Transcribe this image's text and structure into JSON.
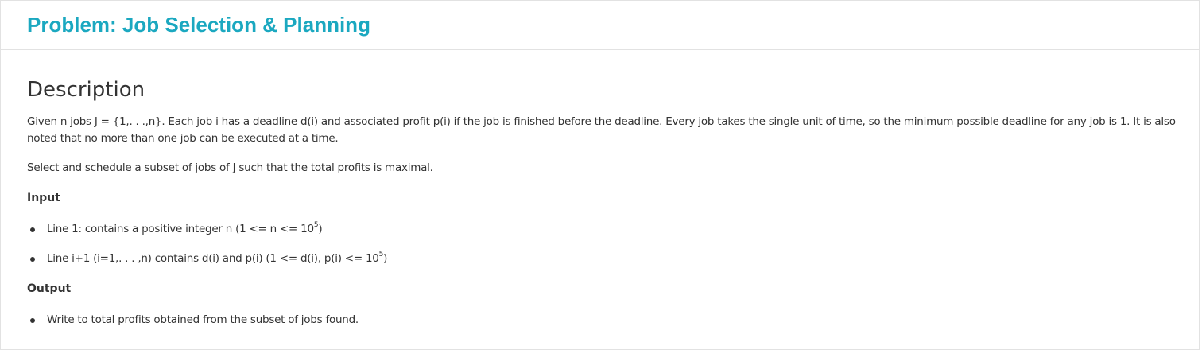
{
  "header": {
    "title": "Problem: Job Selection & Planning"
  },
  "description": {
    "heading": "Description",
    "paragraph1": "Given n jobs J = {1,. . .,n}. Each job i has a deadline d(i) and associated profit p(i) if the job is finished before the deadline. Every job takes the single unit of time, so the minimum possible deadline for any job is 1. It is also noted that no more than one job can be executed at a time.",
    "paragraph2": "Select and schedule a subset of jobs of J such that the total profits is maximal."
  },
  "input": {
    "heading": "Input",
    "line1": {
      "text": "Line 1: contains a positive integer n (1 <= n <= 10",
      "sup": "5",
      "tail": ")"
    },
    "line2": {
      "text": "Line i+1 (i=1,. . . ,n) contains d(i) and p(i) (1 <= d(i), p(i) <= 10",
      "sup": "5",
      "tail": ")"
    }
  },
  "output": {
    "heading": "Output",
    "line1": "Write to total profits obtained from the subset of jobs found."
  }
}
